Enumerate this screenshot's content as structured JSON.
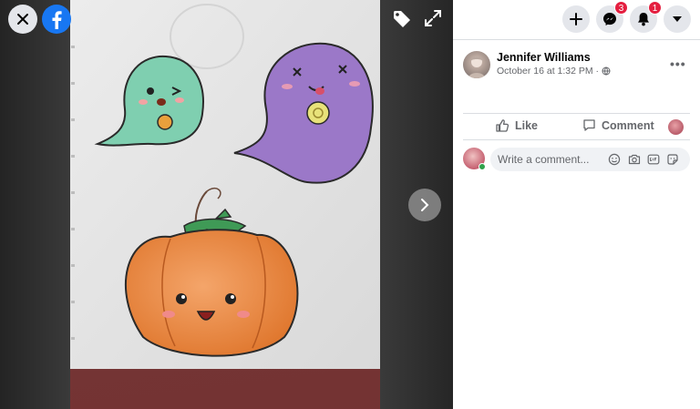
{
  "viewer": {
    "close_icon": "close-icon",
    "logo_icon": "facebook-logo",
    "tag_icon": "tag-icon",
    "expand_icon": "expand-icon",
    "next_icon": "chevron-right-icon"
  },
  "topbar": {
    "create_icon": "plus-icon",
    "messenger_badge": "3",
    "notifications_badge": "1",
    "account_icon": "caret-down-icon"
  },
  "post": {
    "author": "Jennifer Williams",
    "timestamp": "October 16 at 1:32 PM ·",
    "audience_icon": "globe-icon",
    "more_label": "•••"
  },
  "actions": {
    "like_label": "Like",
    "comment_label": "Comment"
  },
  "composer": {
    "placeholder": "Write a comment...",
    "icons": [
      "emoji-icon",
      "camera-icon",
      "gif-icon",
      "sticker-icon"
    ]
  },
  "colors": {
    "facebook_blue": "#1877f2",
    "badge_red": "#e41e3f",
    "online_green": "#31a24c"
  }
}
